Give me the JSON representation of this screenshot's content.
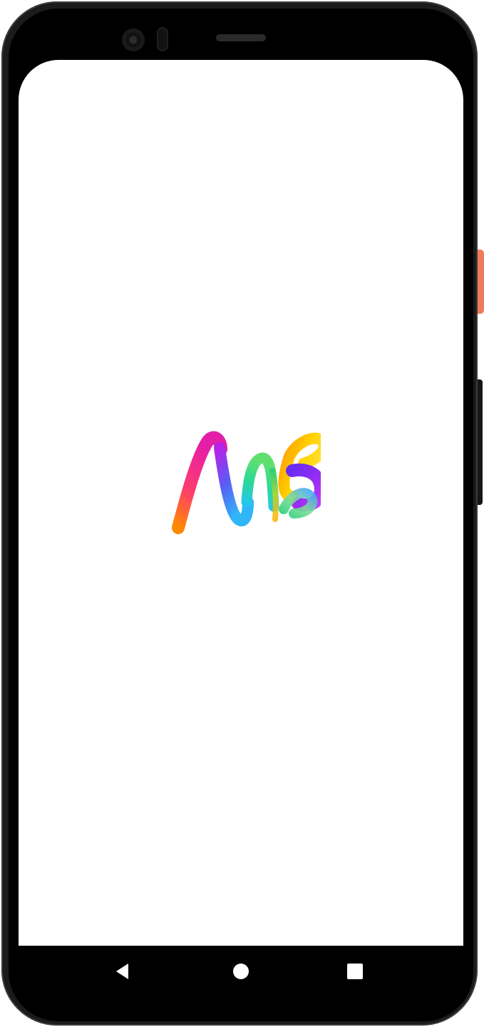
{
  "app": {
    "splash_logo": "ms-rainbow-logo",
    "background_color": "#ffffff"
  },
  "device": {
    "frame_color": "#000000",
    "power_button_color": "#f07a5c"
  },
  "navigation_bar": {
    "background_color": "#000000",
    "icon_color": "#ffffff",
    "buttons": [
      {
        "name": "back",
        "icon": "triangle-left-icon"
      },
      {
        "name": "home",
        "icon": "circle-icon"
      },
      {
        "name": "recents",
        "icon": "square-icon"
      }
    ]
  }
}
